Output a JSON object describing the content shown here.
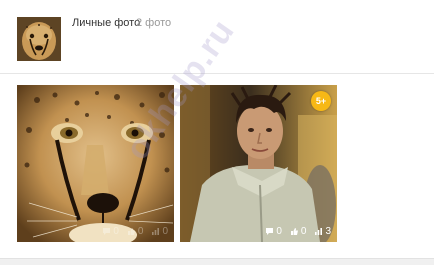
{
  "album": {
    "title": "Личные фото",
    "count": "2 фото"
  },
  "photos": [
    {
      "subject": "cheetah",
      "comments": "0",
      "likes": "0",
      "views": "0"
    },
    {
      "subject": "man-in-jacket",
      "badge": "5+",
      "comments": "0",
      "likes": "0",
      "views": "3"
    }
  ],
  "watermark": "okhelp.ru",
  "colors": {
    "badge": "#f7b816",
    "count_text": "#999999",
    "title_text": "#333333"
  },
  "icons": [
    "comment-icon",
    "like-icon",
    "views-icon"
  ]
}
